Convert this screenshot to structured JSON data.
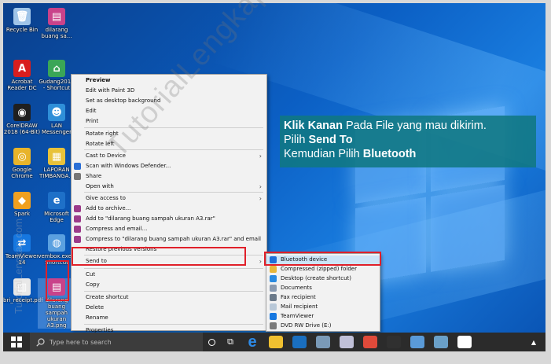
{
  "desktop_icons": [
    {
      "label": "Recycle Bin",
      "glyph": "🗑",
      "color": "#9fc4e8"
    },
    {
      "label": "dilarang buang sa...",
      "glyph": "▤",
      "color": "#c9428a"
    },
    {
      "label": "Acrobat Reader DC",
      "glyph": "A",
      "color": "#d81e1e"
    },
    {
      "label": "Gudang2011 - Shortcut",
      "glyph": "⌂",
      "color": "#3aa657"
    },
    {
      "label": "CorelDRAW 2018 (64-Bit)",
      "glyph": "◉",
      "color": "#1f1f1f"
    },
    {
      "label": "LAN Messenger",
      "glyph": "☻",
      "color": "#2f8fd8"
    },
    {
      "label": "Google Chrome",
      "glyph": "◎",
      "color": "#e8b42a"
    },
    {
      "label": "LAPORAN TIMBANGA...",
      "glyph": "▦",
      "color": "#e8c23a"
    },
    {
      "label": "Spark",
      "glyph": "◆",
      "color": "#f0a020"
    },
    {
      "label": "Microsoft Edge",
      "glyph": "e",
      "color": "#1e70c8"
    },
    {
      "label": "TeamViewer 14",
      "glyph": "⇄",
      "color": "#1677e0"
    },
    {
      "label": "vembox.exe - Shortcut",
      "glyph": "◍",
      "color": "#5aa0e0"
    },
    {
      "label": "bri_receipt.pdf",
      "glyph": "▥",
      "color": "#e8e8e8"
    },
    {
      "label": "dilarang buang sampah ukuran A3.png",
      "glyph": "▤",
      "color": "#c9428a"
    }
  ],
  "context_menu": {
    "items": [
      {
        "label": "Preview",
        "bold": true
      },
      {
        "label": "Edit with Paint 3D"
      },
      {
        "label": "Set as desktop background"
      },
      {
        "label": "Edit"
      },
      {
        "label": "Print"
      },
      {
        "label": "Rotate right"
      },
      {
        "label": "Rotate left"
      },
      {
        "label": "Cast to Device",
        "arrow": true
      },
      {
        "label": "Scan with Windows Defender...",
        "icon": "defender-icon",
        "icolor": "#2a6fd6"
      },
      {
        "label": "Share",
        "icon": "share-icon",
        "icolor": "#777777"
      },
      {
        "label": "Open with",
        "arrow": true
      },
      {
        "label": "Give access to",
        "arrow": true
      },
      {
        "label": "Add to archive...",
        "icon": "winrar-icon",
        "icolor": "#9c3b8a"
      },
      {
        "label": "Add to \"dilarang buang sampah ukuran A3.rar\"",
        "icon": "winrar-icon",
        "icolor": "#9c3b8a"
      },
      {
        "label": "Compress and email...",
        "icon": "winrar-icon",
        "icolor": "#9c3b8a"
      },
      {
        "label": "Compress to \"dilarang buang sampah ukuran A3.rar\" and email",
        "icon": "winrar-icon",
        "icolor": "#9c3b8a"
      },
      {
        "label": "Restore previous versions"
      },
      {
        "label": "Send to",
        "arrow": true
      },
      {
        "label": "Cut"
      },
      {
        "label": "Copy"
      },
      {
        "label": "Create shortcut"
      },
      {
        "label": "Delete"
      },
      {
        "label": "Rename"
      },
      {
        "label": "Properties"
      }
    ]
  },
  "send_to_menu": {
    "items": [
      {
        "label": "Bluetooth device",
        "icon": "bluetooth-icon",
        "icolor": "#1e6fd8"
      },
      {
        "label": "Compressed (zipped) folder",
        "icon": "zip-folder-icon",
        "icolor": "#e8b73a"
      },
      {
        "label": "Desktop (create shortcut)",
        "icon": "desktop-icon",
        "icolor": "#2a8ae0"
      },
      {
        "label": "Documents",
        "icon": "documents-icon",
        "icolor": "#8a9ab0"
      },
      {
        "label": "Fax recipient",
        "icon": "fax-icon",
        "icolor": "#6b7a8a"
      },
      {
        "label": "Mail recipient",
        "icon": "mail-icon",
        "icolor": "#b8c8d8"
      },
      {
        "label": "TeamViewer",
        "icon": "teamviewer-icon",
        "icolor": "#1677e0"
      },
      {
        "label": "DVD RW Drive (E:)",
        "icon": "dvd-drive-icon",
        "icolor": "#7a7a7a"
      }
    ]
  },
  "note": {
    "line1_bold": "Klik Kanan",
    "line1_rest": " Pada File yang mau dikirim.",
    "line2_pre": "Pilih ",
    "line2_bold": "Send To",
    "line3_pre": "Kemudian Pilih ",
    "line3_bold": "Bluetooth"
  },
  "watermark": "TutorialLengkap.com",
  "taskbar": {
    "search_placeholder": "Type here to search",
    "apps": [
      {
        "name": "file-explorer-icon",
        "color": "#f0c030"
      },
      {
        "name": "outlook-icon",
        "color": "#1a6fc0"
      },
      {
        "name": "paint-icon",
        "color": "#7a9ab8"
      },
      {
        "name": "snipping-icon",
        "color": "#c0c0d8"
      },
      {
        "name": "chrome-icon",
        "color": "#e04a3a"
      },
      {
        "name": "terminal-icon",
        "color": "#303030"
      },
      {
        "name": "circle-app-icon",
        "color": "#5a9ad8"
      },
      {
        "name": "snip-app-icon",
        "color": "#6aa0c8"
      },
      {
        "name": "word-icon",
        "color": "#ffffff"
      }
    ],
    "tray": "▲"
  }
}
